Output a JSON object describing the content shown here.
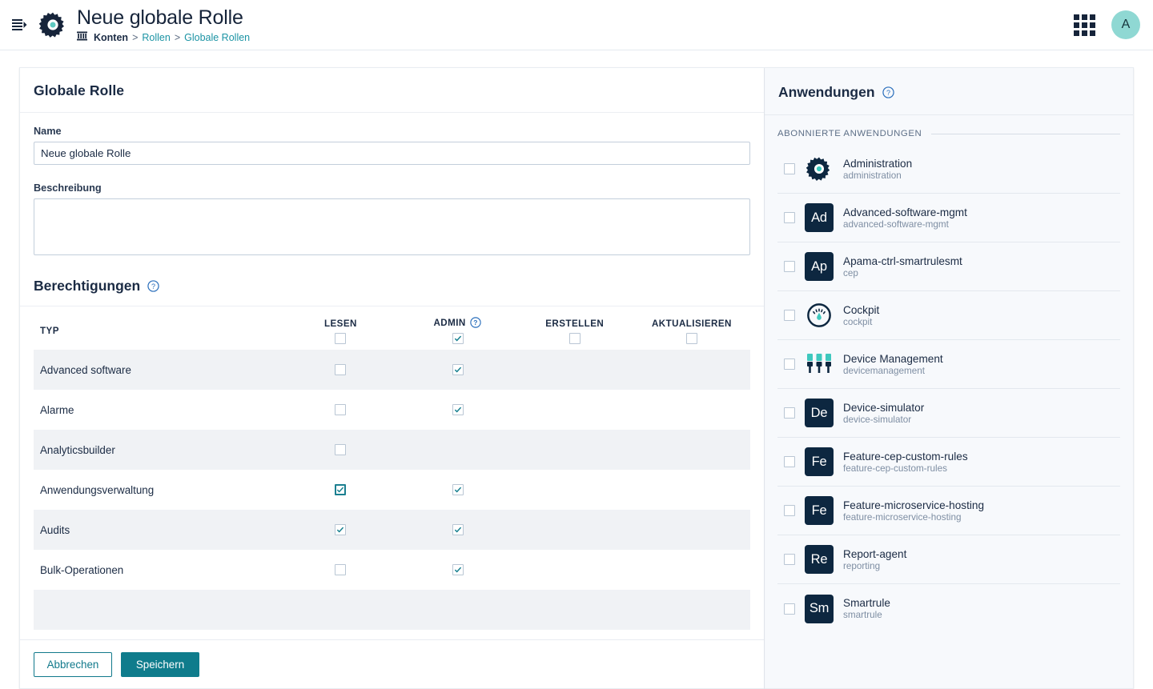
{
  "header": {
    "menu_icon": "hamburger-icon",
    "app_icon": "gear-icon",
    "title": "Neue globale Rolle",
    "breadcrumb": {
      "root_icon": "bank-icon",
      "root": "Konten",
      "sep1": ">",
      "link1": "Rollen",
      "sep2": ">",
      "link2": "Globale Rollen"
    },
    "apps_switcher_icon": "grid-icon",
    "avatar_initial": "A"
  },
  "left_panel": {
    "title": "Globale Rolle",
    "name_label": "Name",
    "name_value": "Neue globale Rolle",
    "name_placeholder": "",
    "description_label": "Beschreibung",
    "description_value": "",
    "description_placeholder": "",
    "permissions_title": "Berechtigungen",
    "permissions_help_icon": "help-circle-icon",
    "table": {
      "columns": [
        "TYP",
        "LESEN",
        "ADMIN",
        "ERSTELLEN",
        "AKTUALISIEREN"
      ],
      "admin_help_icon": "help-circle-icon",
      "header_toggles": [
        {
          "column": "LESEN",
          "checked": false
        },
        {
          "column": "ADMIN",
          "checked": true
        },
        {
          "column": "ERSTELLEN",
          "checked": false
        },
        {
          "column": "AKTUALISIEREN",
          "checked": false
        }
      ],
      "rows": [
        {
          "typ": "Advanced software",
          "lesen": {
            "visible": true,
            "checked": false,
            "focused": false
          },
          "admin": {
            "visible": true,
            "checked": true,
            "focused": false
          },
          "erstellen": {
            "visible": false
          },
          "aktualisieren": {
            "visible": false
          }
        },
        {
          "typ": "Alarme",
          "lesen": {
            "visible": true,
            "checked": false,
            "focused": false
          },
          "admin": {
            "visible": true,
            "checked": true,
            "focused": false
          },
          "erstellen": {
            "visible": false
          },
          "aktualisieren": {
            "visible": false
          }
        },
        {
          "typ": "Analyticsbuilder",
          "lesen": {
            "visible": true,
            "checked": false,
            "focused": false
          },
          "admin": {
            "visible": false
          },
          "erstellen": {
            "visible": false
          },
          "aktualisieren": {
            "visible": false
          }
        },
        {
          "typ": "Anwendungsverwaltung",
          "lesen": {
            "visible": true,
            "checked": true,
            "focused": true
          },
          "admin": {
            "visible": true,
            "checked": true,
            "focused": false
          },
          "erstellen": {
            "visible": false
          },
          "aktualisieren": {
            "visible": false
          }
        },
        {
          "typ": "Audits",
          "lesen": {
            "visible": true,
            "checked": true,
            "focused": false
          },
          "admin": {
            "visible": true,
            "checked": true,
            "focused": false
          },
          "erstellen": {
            "visible": false
          },
          "aktualisieren": {
            "visible": false
          }
        },
        {
          "typ": "Bulk-Operationen",
          "lesen": {
            "visible": true,
            "checked": false,
            "focused": false
          },
          "admin": {
            "visible": true,
            "checked": true,
            "focused": false
          },
          "erstellen": {
            "visible": false
          },
          "aktualisieren": {
            "visible": false
          }
        },
        {
          "typ": "",
          "lesen": {
            "visible": false
          },
          "admin": {
            "visible": false
          },
          "erstellen": {
            "visible": false
          },
          "aktualisieren": {
            "visible": false
          }
        }
      ]
    },
    "cancel_label": "Abbrechen",
    "save_label": "Speichern"
  },
  "right_panel": {
    "title": "Anwendungen",
    "help_icon": "help-circle-icon",
    "group_label": "ABONNIERTE ANWENDUNGEN",
    "apps": [
      {
        "name": "Administration",
        "key": "administration",
        "icon": "gear-icon",
        "initials": "",
        "checked": false
      },
      {
        "name": "Advanced-software-mgmt",
        "key": "advanced-software-mgmt",
        "icon": "tile",
        "initials": "Ad",
        "checked": false
      },
      {
        "name": "Apama-ctrl-smartrulesmt",
        "key": "cep",
        "icon": "tile",
        "initials": "Ap",
        "checked": false
      },
      {
        "name": "Cockpit",
        "key": "cockpit",
        "icon": "gauge-icon",
        "initials": "",
        "checked": false
      },
      {
        "name": "Device Management",
        "key": "devicemanagement",
        "icon": "devices-icon",
        "initials": "",
        "checked": false
      },
      {
        "name": "Device-simulator",
        "key": "device-simulator",
        "icon": "tile",
        "initials": "De",
        "checked": false
      },
      {
        "name": "Feature-cep-custom-rules",
        "key": "feature-cep-custom-rules",
        "icon": "tile",
        "initials": "Fe",
        "checked": false
      },
      {
        "name": "Feature-microservice-hosting",
        "key": "feature-microservice-hosting",
        "icon": "tile",
        "initials": "Fe",
        "checked": false
      },
      {
        "name": "Report-agent",
        "key": "reporting",
        "icon": "tile",
        "initials": "Re",
        "checked": false
      },
      {
        "name": "Smartrule",
        "key": "smartrule",
        "icon": "tile",
        "initials": "Sm",
        "checked": false
      }
    ]
  },
  "colors": {
    "accent_teal": "#0f7c8c",
    "link_teal": "#1b93a4",
    "dark_navy": "#16243a",
    "tile_navy": "#0d2740",
    "avatar_mint": "#8fd8d3",
    "help_blue": "#2a6ebb",
    "row_stripe": "#f0f2f5",
    "right_panel_bg": "#f7f9fc"
  }
}
